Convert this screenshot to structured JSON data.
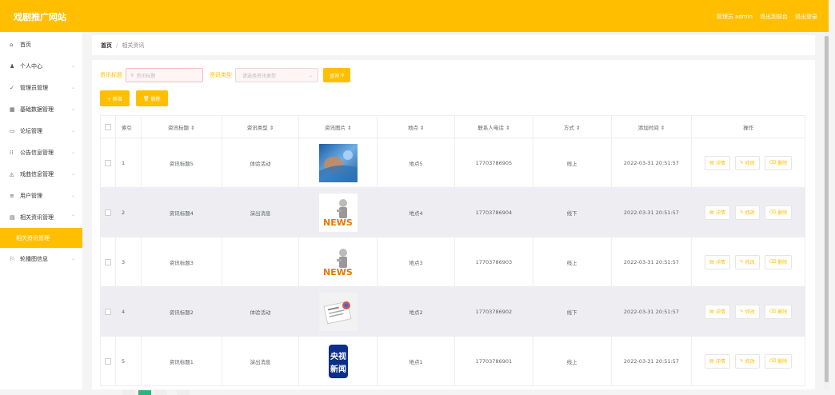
{
  "header": {
    "title": "戏剧推广网站",
    "user": "管理员 admin",
    "back_front": "退出到前台",
    "logout": "退出登录"
  },
  "sidebar": {
    "items": [
      {
        "label": "首页",
        "icon": "home-icon",
        "glyph": "⌂",
        "arrow": ""
      },
      {
        "label": "个人中心",
        "icon": "user-icon",
        "glyph": "♟",
        "arrow": "⌄"
      },
      {
        "label": "管理员管理",
        "icon": "send-icon",
        "glyph": "✓",
        "arrow": "⌄"
      },
      {
        "label": "基础数据管理",
        "icon": "database-icon",
        "glyph": "▦",
        "arrow": "⌄"
      },
      {
        "label": "论坛管理",
        "icon": "chat-icon",
        "glyph": "▭",
        "arrow": "⌄"
      },
      {
        "label": "公告信息管理",
        "icon": "grid-icon",
        "glyph": "⁞⁞",
        "arrow": "⌄"
      },
      {
        "label": "戏曲信息管理",
        "icon": "drama-icon",
        "glyph": "◬",
        "arrow": "⌄"
      },
      {
        "label": "用户管理",
        "icon": "list-icon",
        "glyph": "≡",
        "arrow": "⌄"
      },
      {
        "label": "相关资讯管理",
        "icon": "news-icon",
        "glyph": "▤",
        "arrow": "⌃"
      },
      {
        "label": "相关资讯管理",
        "icon": "",
        "glyph": "",
        "arrow": "",
        "sub": true
      },
      {
        "label": "轮播图信息",
        "icon": "image-icon",
        "glyph": "⚐",
        "arrow": "⌄"
      }
    ]
  },
  "breadcrumb": {
    "home": "首页",
    "sep": "/",
    "current": "相关资讯"
  },
  "search": {
    "title_label": "资讯标题",
    "title_placeholder": "资讯标题",
    "type_label": "资讯类型",
    "type_placeholder": "请选择资讯类型",
    "query_button": "查询",
    "query_icon": "search-icon"
  },
  "actions": {
    "add": "+ 新增",
    "delete": "删除",
    "delete_icon": "trash-icon"
  },
  "table": {
    "headers": [
      "索引",
      "资讯标题 ⇕",
      "资讯类型 ⇕",
      "资讯图片 ⇕",
      "地点 ⇕",
      "联系人电话 ⇕",
      "方式 ⇕",
      "添加时间 ⇕",
      "操作"
    ],
    "rows": [
      {
        "index": "1",
        "title": "资讯标题5",
        "type": "体验活动",
        "image": "blue-abstract",
        "place": "地点5",
        "phone": "17703786905",
        "mode": "线上",
        "time": "2022-03-31 20:51:57"
      },
      {
        "index": "2",
        "title": "资讯标题4",
        "type": "演出消息",
        "image": "news-figure",
        "place": "地点4",
        "phone": "17703786904",
        "mode": "线下",
        "time": "2022-03-31 20:51:57"
      },
      {
        "index": "3",
        "title": "资讯标题3",
        "type": "",
        "image": "news-figure",
        "place": "地点3",
        "phone": "17703786903",
        "mode": "线上",
        "time": "2022-03-31 20:51:57"
      },
      {
        "index": "4",
        "title": "资讯标题2",
        "type": "体验活动",
        "image": "newspaper",
        "place": "地点2",
        "phone": "17703786902",
        "mode": "线下",
        "time": "2022-03-31 20:51:57"
      },
      {
        "index": "5",
        "title": "资讯标题1",
        "type": "演出消息",
        "image": "cctv-news",
        "place": "地点1",
        "phone": "17703786901",
        "mode": "线上",
        "time": "2022-03-31 20:51:57"
      }
    ],
    "op_labels": {
      "detail": "详情",
      "edit": "修改",
      "delete": "删除"
    },
    "cctv_logo_text": [
      "央视",
      "新闻"
    ],
    "news_logo_text": "NEWS"
  },
  "colors": {
    "accent": "#ffbf00",
    "alt_row": "#eeeef2",
    "pager_active": "#2bb57d"
  }
}
